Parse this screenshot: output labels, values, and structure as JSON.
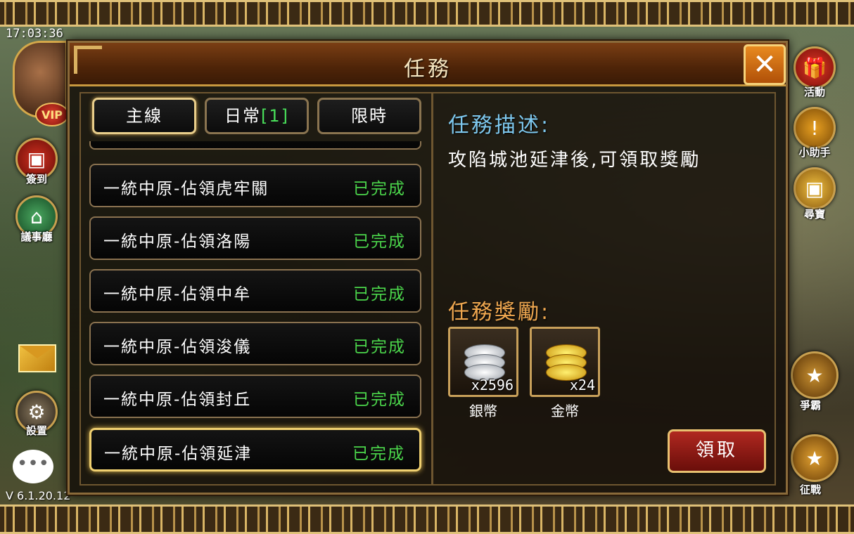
{
  "hud": {
    "clock": "17:03:36",
    "version": "V 6.1.20.12",
    "vip_label": "VIP",
    "left_buttons": [
      {
        "label": "簽到",
        "icon": "calendar-icon"
      },
      {
        "label": "議事廳",
        "icon": "pavilion-icon"
      },
      {
        "label": "設置",
        "icon": "gear-icon"
      }
    ],
    "right_buttons": [
      {
        "label": "活動",
        "icon": "gift-icon"
      },
      {
        "label": "小助手",
        "icon": "exclamation-icon"
      },
      {
        "label": "尋寶",
        "icon": "treasure-chest-icon"
      },
      {
        "label": "爭霸",
        "icon": "dragon-icon"
      },
      {
        "label": "征戰",
        "icon": "dragon-icon"
      }
    ]
  },
  "dialog": {
    "title": "任務",
    "close_icon": "close-icon",
    "tabs": [
      {
        "label": "主線",
        "count": "",
        "active": true
      },
      {
        "label": "日常",
        "count": "[1]",
        "active": false
      },
      {
        "label": "限時",
        "count": "",
        "active": false
      }
    ],
    "quests": [
      {
        "name": "一統中原-佔領虎牢關",
        "status": "已完成"
      },
      {
        "name": "一統中原-佔領洛陽",
        "status": "已完成"
      },
      {
        "name": "一統中原-佔領中牟",
        "status": "已完成"
      },
      {
        "name": "一統中原-佔領浚儀",
        "status": "已完成"
      },
      {
        "name": "一統中原-佔領封丘",
        "status": "已完成"
      },
      {
        "name": "一統中原-佔領延津",
        "status": "已完成",
        "selected": true
      }
    ],
    "description_title": "任務描述:",
    "description_text": "攻陷城池延津後,可領取獎勵",
    "rewards_title": "任務獎勵:",
    "rewards": [
      {
        "name": "銀幣",
        "count": "x2596",
        "icon": "silver-coins-icon"
      },
      {
        "name": "金幣",
        "count": "x24",
        "icon": "gold-coins-icon"
      }
    ],
    "claim_label": "領取"
  },
  "colors": {
    "accent_gold": "#e8cd8a",
    "completed_green": "#4bd64b",
    "description_title": "#7ec8ee",
    "rewards_title": "#f0a850",
    "claim_red": "#b02820"
  }
}
